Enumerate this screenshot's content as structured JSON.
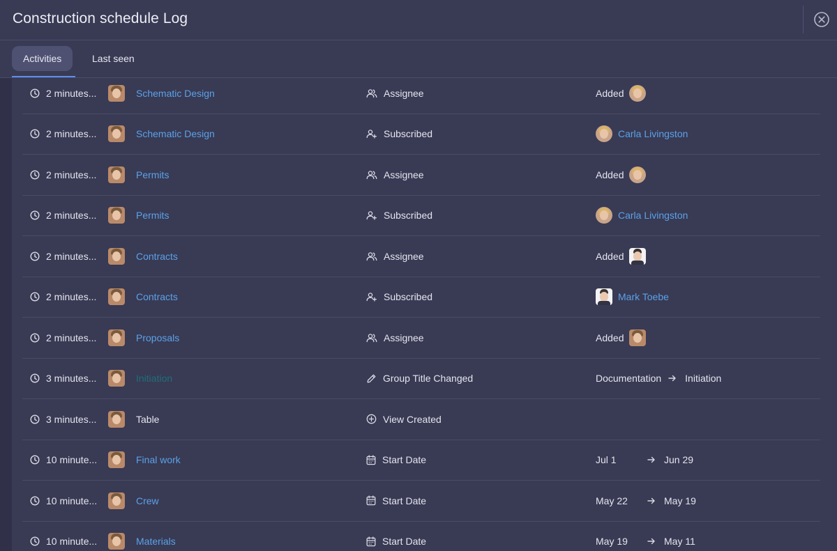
{
  "window": {
    "title": "Construction schedule Log"
  },
  "tabs": [
    {
      "label": "Activities",
      "active": true
    },
    {
      "label": "Last seen",
      "active": false
    }
  ],
  "colors": {
    "link": "#5aa2e8",
    "link_teal": "#1f6f78",
    "tab_underline": "#5b8def"
  },
  "rows": [
    {
      "time": "2 minutes...",
      "item": "Schematic Design",
      "item_style": "link",
      "action_icon": "people-icon",
      "action": "Assignee",
      "change_type": "added",
      "change_text": "Added",
      "change_avatar": "woman"
    },
    {
      "time": "2 minutes...",
      "item": "Schematic Design",
      "item_style": "link",
      "action_icon": "person-add-icon",
      "action": "Subscribed",
      "change_type": "user",
      "change_avatar": "woman",
      "change_user": "Carla Livingston"
    },
    {
      "time": "2 minutes...",
      "item": "Permits",
      "item_style": "link",
      "action_icon": "people-icon",
      "action": "Assignee",
      "change_type": "added",
      "change_text": "Added",
      "change_avatar": "woman"
    },
    {
      "time": "2 minutes...",
      "item": "Permits",
      "item_style": "link",
      "action_icon": "person-add-icon",
      "action": "Subscribed",
      "change_type": "user",
      "change_avatar": "woman",
      "change_user": "Carla Livingston"
    },
    {
      "time": "2 minutes...",
      "item": "Contracts",
      "item_style": "link",
      "action_icon": "people-icon",
      "action": "Assignee",
      "change_type": "added",
      "change_text": "Added",
      "change_avatar": "man"
    },
    {
      "time": "2 minutes...",
      "item": "Contracts",
      "item_style": "link",
      "action_icon": "person-add-icon",
      "action": "Subscribed",
      "change_type": "user",
      "change_avatar": "man",
      "change_user": "Mark Toebe"
    },
    {
      "time": "2 minutes...",
      "item": "Proposals",
      "item_style": "link",
      "action_icon": "people-icon",
      "action": "Assignee",
      "change_type": "added",
      "change_text": "Added",
      "change_avatar": "author"
    },
    {
      "time": "3 minutes...",
      "item": "Initiation",
      "item_style": "teal",
      "action_icon": "pencil-icon",
      "action": "Group Title Changed",
      "change_type": "transition",
      "change_from": "Documentation",
      "change_to": "Initiation"
    },
    {
      "time": "3 minutes...",
      "item": "Table",
      "item_style": "plain",
      "action_icon": "plus-circle-icon",
      "action": "View Created",
      "change_type": "none"
    },
    {
      "time": "10 minute...",
      "item": "Final work",
      "item_style": "link",
      "action_icon": "calendar-icon",
      "action": "Start Date",
      "change_type": "date",
      "change_from": "Jul 1",
      "change_to": "Jun 29"
    },
    {
      "time": "10 minute...",
      "item": "Crew",
      "item_style": "link",
      "action_icon": "calendar-icon",
      "action": "Start Date",
      "change_type": "date",
      "change_from": "May 22",
      "change_to": "May 19"
    },
    {
      "time": "10 minute...",
      "item": "Materials",
      "item_style": "link",
      "action_icon": "calendar-icon",
      "action": "Start Date",
      "change_type": "date",
      "change_from": "May 19",
      "change_to": "May 11"
    }
  ]
}
